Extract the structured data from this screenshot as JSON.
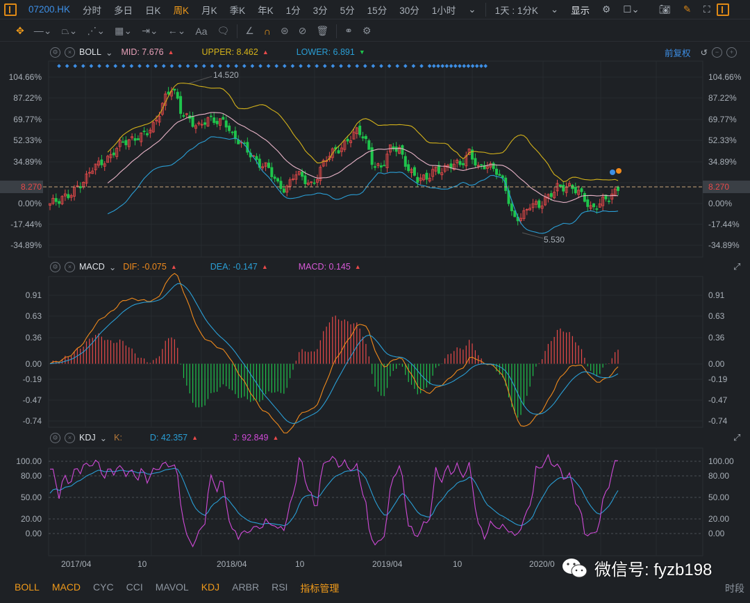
{
  "topbar": {
    "ticker": "07200.HK",
    "periods": [
      "分时",
      "多日",
      "日K",
      "周K",
      "月K",
      "季K",
      "年K",
      "1分",
      "3分",
      "5分",
      "15分",
      "30分",
      "1小时"
    ],
    "active_period": "周K",
    "session": "1天 : 1分K",
    "display": "显示"
  },
  "toolbar": {
    "text_tool": "Aa"
  },
  "boll": {
    "name": "BOLL",
    "mid": "MID: 7.676",
    "upper": "UPPER: 8.462",
    "lower": "LOWER: 6.891",
    "restore": "前复权",
    "y_ticks": [
      "104.66%",
      "87.22%",
      "69.77%",
      "52.33%",
      "34.89%",
      "0.00%",
      "-17.44%",
      "-34.89%"
    ],
    "last_price": "8.270",
    "high_label": "14.520",
    "low_label": "5.530"
  },
  "macd": {
    "name": "MACD",
    "dif": "DIF: -0.075",
    "dea": "DEA: -0.147",
    "macd": "MACD: 0.145",
    "y_ticks": [
      "0.91",
      "0.63",
      "0.36",
      "0.00",
      "-0.19",
      "-0.47",
      "-0.74"
    ]
  },
  "kdj": {
    "name": "KDJ",
    "k": "K:",
    "d": "D: 42.357",
    "j": "J: 92.849",
    "y_ticks": [
      "100.00",
      "80.00",
      "50.00",
      "20.00",
      "0.00"
    ]
  },
  "x_axis": [
    "2017/04",
    "10",
    "2018/04",
    "10",
    "2019/04",
    "10",
    "2020/0"
  ],
  "bottom": {
    "tabs": [
      "BOLL",
      "MACD",
      "CYC",
      "CCI",
      "MAVOL",
      "KDJ",
      "ARBR",
      "RSI",
      "指标管理"
    ],
    "active": [
      "BOLL",
      "MACD",
      "KDJ",
      "指标管理"
    ],
    "right": "时段"
  },
  "watermark": "微信号: fyzb198",
  "colors": {
    "up": "#e84a4a",
    "down": "#1fc44c",
    "mid": "#e8b4c8",
    "upper": "#d4b21a",
    "lower": "#2a9fd6",
    "dif": "#f08a1c",
    "dea": "#2a9fd6",
    "j": "#d04ad8",
    "accent": "#f09a1a"
  },
  "chart_data": {
    "type": "candlestick",
    "weeks": 188,
    "base_price": 7.27,
    "price_ylim": [
      4.13,
      15.35
    ],
    "close_anchors": [
      7.27,
      7.31,
      7.81,
      8.32,
      8.53,
      9.49,
      9.91,
      10.12,
      10.74,
      11.16,
      11.37,
      11.37,
      11.98,
      13.67,
      14.3,
      12.63,
      12.42,
      11.98,
      12.21,
      12.21,
      12.42,
      11.16,
      10.74,
      10.32,
      9.7,
      9.28,
      8.44,
      8.23,
      9.07,
      8.65,
      8.44,
      9.49,
      10.12,
      10.53,
      11.16,
      11.58,
      11.16,
      9.7,
      9.49,
      10.53,
      10.53,
      9.49,
      8.65,
      8.65,
      9.49,
      9.28,
      9.49,
      9.7,
      10.53,
      9.28,
      9.49,
      9.49,
      8.44,
      6.14,
      6.56,
      7.4,
      6.98,
      7.6,
      8.44,
      8.23,
      8.02,
      7.81,
      6.98,
      7.19,
      7.6,
      8.32
    ],
    "macd_ylim": [
      -0.83,
      1.14
    ],
    "kdj_ylim": [
      -31,
      118
    ]
  }
}
